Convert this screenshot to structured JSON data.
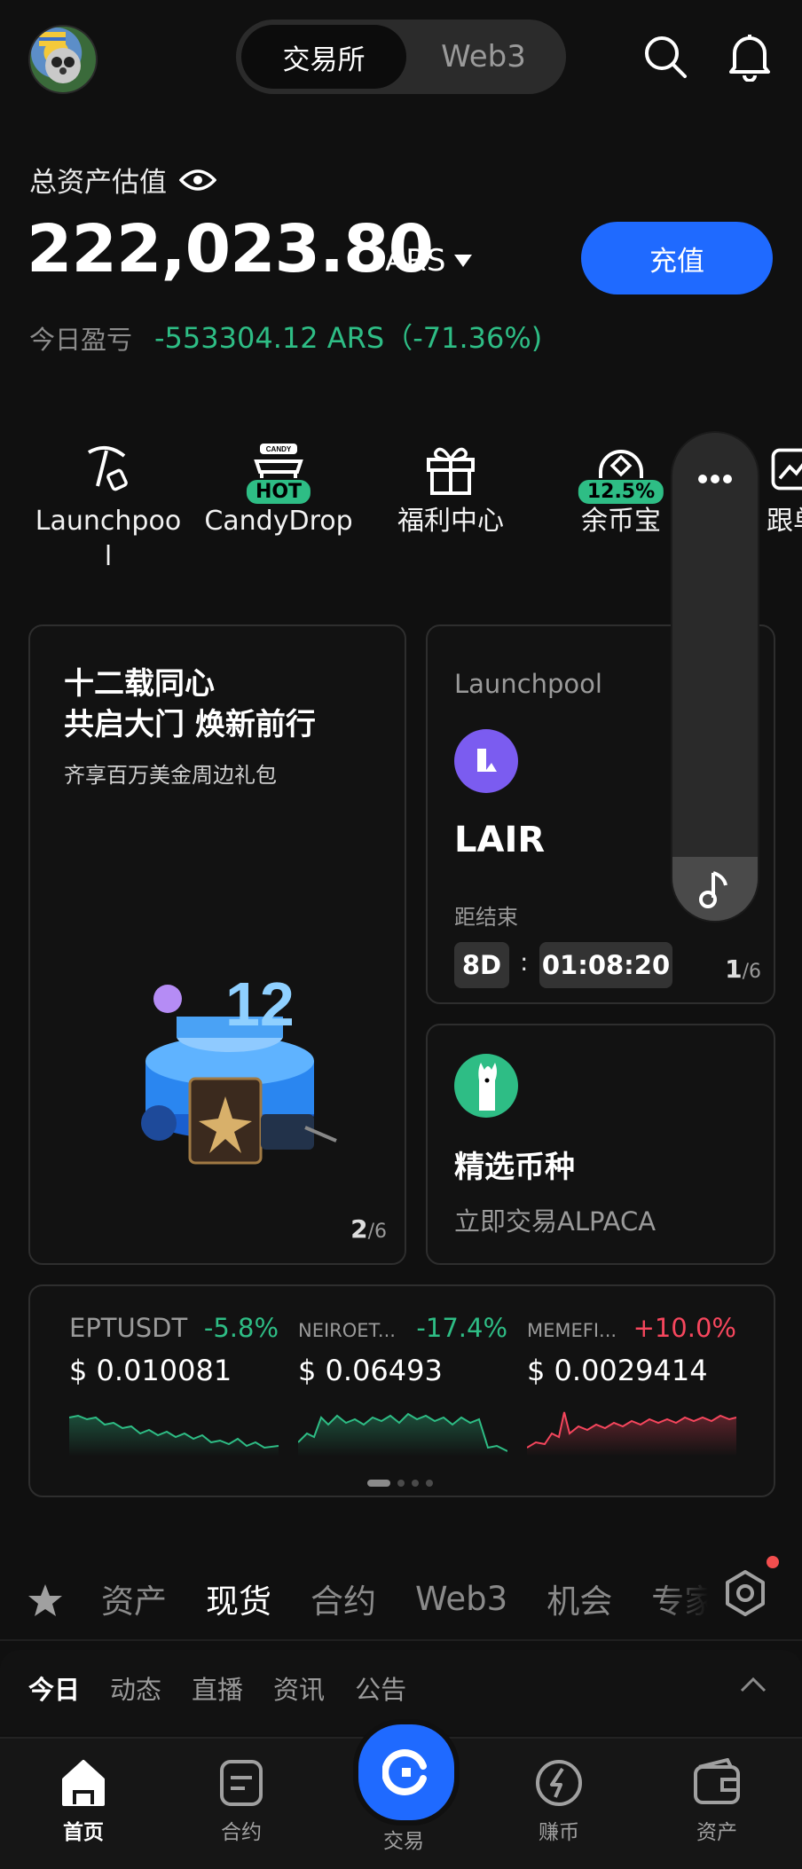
{
  "header": {
    "toggle": {
      "exchange": "交易所",
      "web3": "Web3"
    }
  },
  "assets": {
    "label": "总资产估值",
    "value": "222,023.80",
    "currency": "ARS",
    "deposit": "充值",
    "pnl_label": "今日盈亏",
    "pnl_value": "-553304.12 ARS（-71.36%)"
  },
  "quick": [
    {
      "label": "Launchpool",
      "icon": "pickaxe-icon"
    },
    {
      "label": "CandyDrop",
      "icon": "candy-icon",
      "badge": "HOT"
    },
    {
      "label": "福利中心",
      "icon": "gift-icon"
    },
    {
      "label": "余币宝",
      "icon": "savings-icon",
      "badge": "12.5%"
    },
    {
      "label": "跟单",
      "icon": "copy-trade-icon"
    }
  ],
  "promo": {
    "title_line1": "十二载同心",
    "title_line2": "共启大门 焕新前行",
    "subtitle": "齐享百万美金周边礼包",
    "page": "2",
    "total": "/6"
  },
  "launchpool": {
    "label": "Launchpool",
    "token": "LAIR",
    "ends_label": "距结束",
    "days": "8D",
    "sep": ":",
    "time": "01:08:20",
    "page": "1",
    "total": "/6"
  },
  "featured": {
    "title": "精选币种",
    "subtitle": "立即交易ALPACA"
  },
  "tickers": [
    {
      "symbol": "EPTUSDT",
      "change": "-5.8%",
      "price": "$ 0.010081",
      "color": "#2ebd85"
    },
    {
      "symbol": "NEIROET...",
      "change": "-17.4%",
      "price": "$ 0.06493",
      "color": "#2ebd85"
    },
    {
      "symbol": "MEMEFI...",
      "change": "+10.0%",
      "price": "$ 0.0029414",
      "color": "#f6465d"
    }
  ],
  "tabs": [
    "资产",
    "现货",
    "合约",
    "Web3",
    "机会",
    "专家"
  ],
  "active_tab": "现货",
  "sub_tabs": [
    "今日",
    "动态",
    "直播",
    "资讯",
    "公告"
  ],
  "nav": {
    "home": "首页",
    "futures": "合约",
    "trade": "交易",
    "earn": "赚币",
    "assets": "资产"
  },
  "colors": {
    "accent": "#1f6aff",
    "up": "#f6465d",
    "down": "#2ebd85"
  }
}
